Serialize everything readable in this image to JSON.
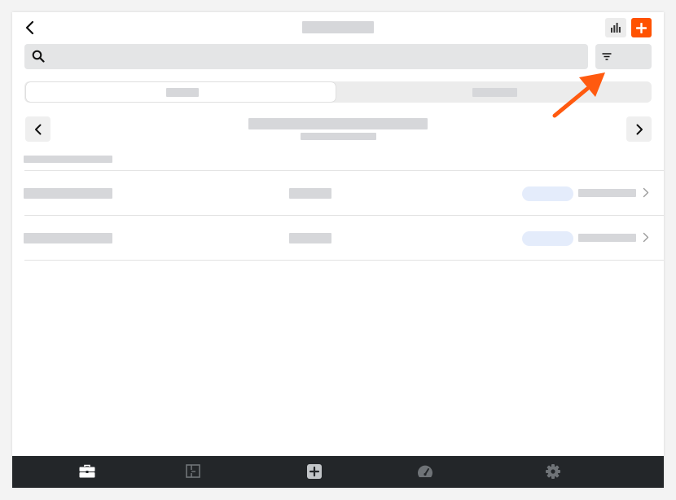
{
  "header": {
    "back_icon": "chevron-left-icon",
    "chart_icon": "bar-chart-icon",
    "add_icon": "plus-icon",
    "accent_color": "#ff5200"
  },
  "search": {
    "icon": "search-icon",
    "placeholder": ""
  },
  "filter": {
    "icon": "filter-icon"
  },
  "tabs": [
    {
      "active": true
    },
    {
      "active": false
    }
  ],
  "date_nav": {
    "prev_icon": "chevron-left-icon",
    "next_icon": "chevron-right-icon"
  },
  "list": {
    "rows": [
      {
        "chevron_icon": "chevron-right-icon"
      },
      {
        "chevron_icon": "chevron-right-icon"
      }
    ]
  },
  "bottom_nav": {
    "items": [
      {
        "icon": "briefcase-icon",
        "active": true
      },
      {
        "icon": "floor-plan-icon",
        "active": false
      },
      {
        "icon": "plus-square-icon",
        "active": false
      },
      {
        "icon": "speedometer-icon",
        "active": false
      },
      {
        "icon": "gear-icon",
        "active": false
      }
    ]
  },
  "annotation": {
    "arrow_color": "#ff5a10"
  }
}
